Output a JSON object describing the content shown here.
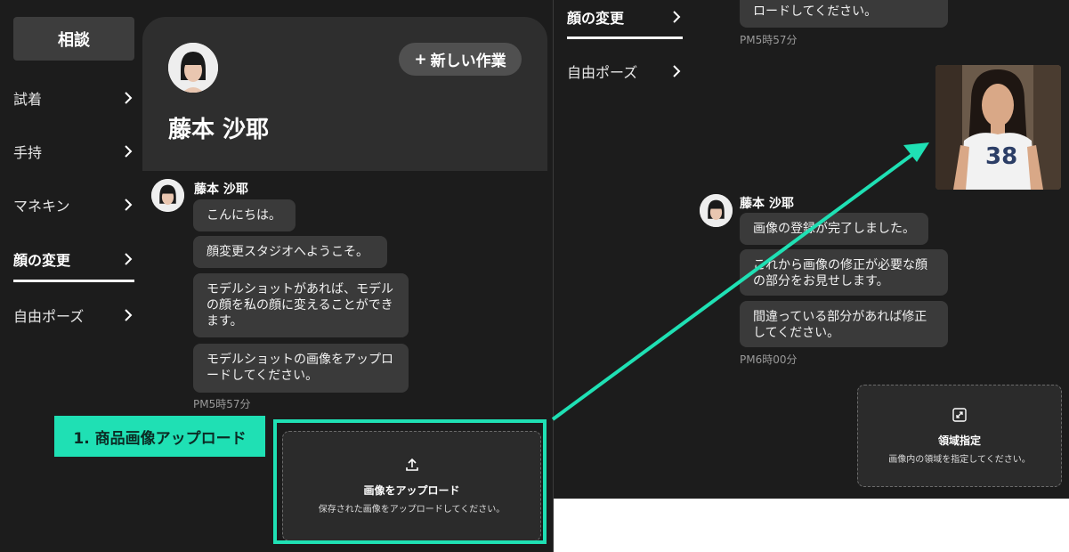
{
  "left_nav": {
    "top_button": "相談",
    "items": [
      {
        "label": "試着"
      },
      {
        "label": "手持"
      },
      {
        "label": "マネキン"
      },
      {
        "label": "顔の変更"
      },
      {
        "label": "自由ポーズ"
      }
    ],
    "active_item": "顔の変更"
  },
  "profile": {
    "name": "藤本 沙耶",
    "new_task_label": "新しい作業"
  },
  "chat_left": {
    "sender": "藤本 沙耶",
    "messages": [
      "こんにちは。",
      "顔変更スタジオへようこそ。",
      "モデルショットがあれば、モデルの顔を私の顔に変えることができます。",
      "モデルショットの画像をアップロードしてください。"
    ],
    "time": "PM5時57分"
  },
  "upload": {
    "title": "画像をアップロード",
    "subtitle": "保存された画像をアップロードしてください。"
  },
  "annotation": {
    "label": "1. 商品画像アップロード",
    "color": "#1fe0b4"
  },
  "right_nav": {
    "items": [
      {
        "label": "顔の変更"
      },
      {
        "label": "自由ポーズ"
      }
    ]
  },
  "chat_right": {
    "partial_message": "ロードしてください。",
    "time_top": "PM5時57分",
    "photo_number": "38",
    "sender": "藤本 沙耶",
    "messages": [
      "画像の登録が完了しました。",
      "これから画像の修正が必要な顔の部分をお見せします。",
      "間違っている部分があれば修正してください。"
    ],
    "time": "PM6時00分"
  },
  "region": {
    "title": "領域指定",
    "subtitle": "画像内の領域を指定してください。"
  }
}
